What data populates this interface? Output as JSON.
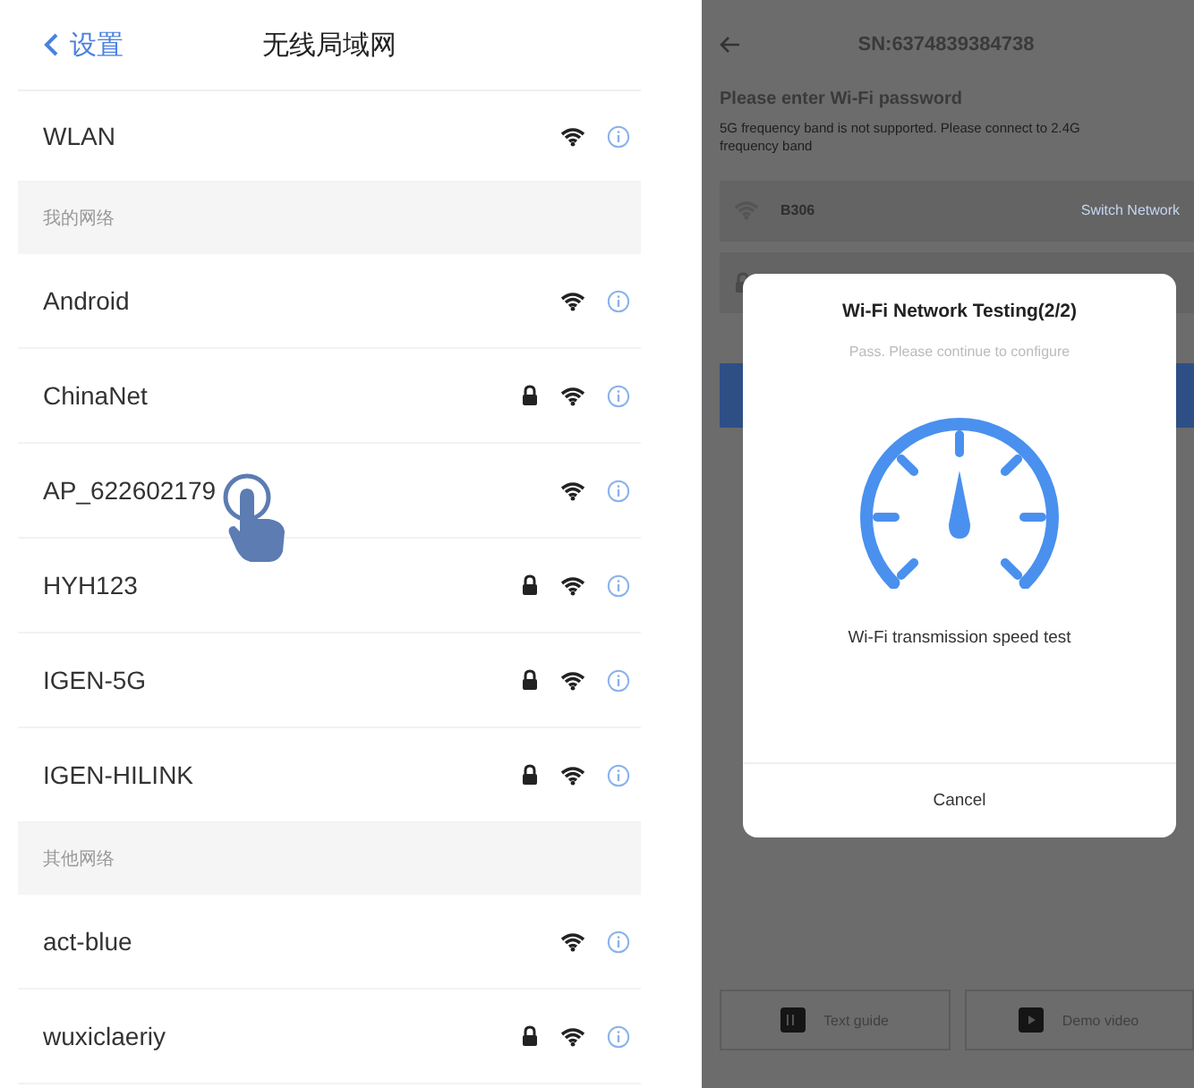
{
  "left_screen": {
    "back_button": {
      "label": "设置"
    },
    "title": "无线局域网",
    "wlan_row": {
      "label": "WLAN",
      "locked": false
    },
    "sections": [
      {
        "header": "我的网络",
        "networks": [
          {
            "name": "Android",
            "locked": false,
            "tapped": false
          },
          {
            "name": "ChinaNet",
            "locked": true,
            "tapped": false
          },
          {
            "name": "AP_622602179",
            "locked": false,
            "tapped": true
          },
          {
            "name": "HYH123",
            "locked": true,
            "tapped": false
          },
          {
            "name": "IGEN-5G",
            "locked": true,
            "tapped": false
          },
          {
            "name": "IGEN-HILINK",
            "locked": true,
            "tapped": false
          }
        ]
      },
      {
        "header": "其他网络",
        "networks": [
          {
            "name": "act-blue",
            "locked": false,
            "tapped": false
          },
          {
            "name": "wuxiclaeriy",
            "locked": true,
            "tapped": false
          }
        ]
      }
    ]
  },
  "right_screen": {
    "title": "SN:6374839384738",
    "heading": "Please enter Wi-Fi password",
    "note": "5G frequency band is not supported. Please connect to 2.4G frequency band",
    "network": {
      "name": "B306",
      "action": "Switch Network"
    },
    "dialog": {
      "title": "Wi-Fi Network Testing(2/2)",
      "subtitle": "Pass. Please continue to configure",
      "caption": "Wi-Fi transmission speed test",
      "cancel": "Cancel"
    },
    "bottom_buttons": [
      {
        "kind": "guide",
        "label": "Text guide"
      },
      {
        "kind": "video",
        "label": "Demo video"
      }
    ]
  }
}
